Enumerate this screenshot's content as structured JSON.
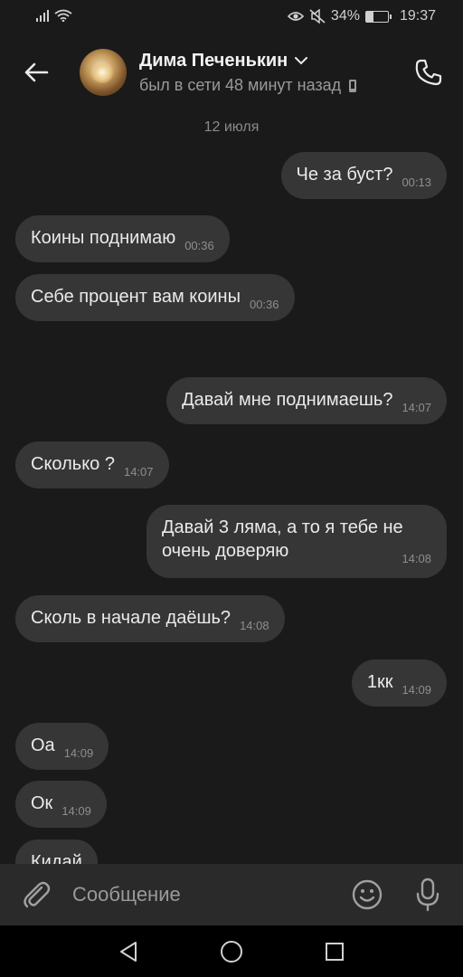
{
  "status_bar": {
    "battery_percent_label": "34%",
    "battery_level": 0.34,
    "time": "19:37",
    "icons": [
      "signal-icon",
      "wifi-icon",
      "eye-icon",
      "mute-icon",
      "battery-icon"
    ]
  },
  "header": {
    "contact_name": "Дима Печенькин",
    "last_seen": "был в сети 48 минут назад",
    "icons": [
      "back-arrow-icon",
      "avatar",
      "chevron-down-icon",
      "mobile-icon",
      "phone-icon"
    ]
  },
  "chat": {
    "date_separator": "12 июля",
    "messages": [
      {
        "dir": "out",
        "text": "Че за буст?",
        "time": "00:13"
      },
      {
        "dir": "in",
        "text": "Коины поднимаю",
        "time": "00:36"
      },
      {
        "dir": "in",
        "text": "Себе процент вам коины",
        "time": "00:36"
      },
      {
        "dir": "out",
        "text": "Давай мне поднимаешь?",
        "time": "14:07"
      },
      {
        "dir": "in",
        "text": "Сколько ?",
        "time": "14:07"
      },
      {
        "dir": "out",
        "text": "Давай 3 ляма, а то я тебе не очень доверяю",
        "time": "14:08"
      },
      {
        "dir": "in",
        "text": "Сколь в начале даёшь?",
        "time": "14:08"
      },
      {
        "dir": "out",
        "text": "1кк",
        "time": "14:09"
      },
      {
        "dir": "in",
        "text": "Оа",
        "time": "14:09"
      },
      {
        "dir": "in",
        "text": "Ок",
        "time": "14:09"
      },
      {
        "dir": "in",
        "text": "Кидай",
        "time": ""
      }
    ]
  },
  "composer": {
    "placeholder": "Сообщение",
    "icons": [
      "attach-icon",
      "emoji-icon",
      "mic-icon"
    ]
  },
  "navbar": {
    "icons": [
      "nav-back-icon",
      "nav-home-icon",
      "nav-recents-icon"
    ]
  },
  "colors": {
    "background": "#1a1a1a",
    "bubble": "#363636",
    "composer": "#2a2a2a",
    "text": "#eaeaea",
    "muted": "#8e8e8e"
  }
}
